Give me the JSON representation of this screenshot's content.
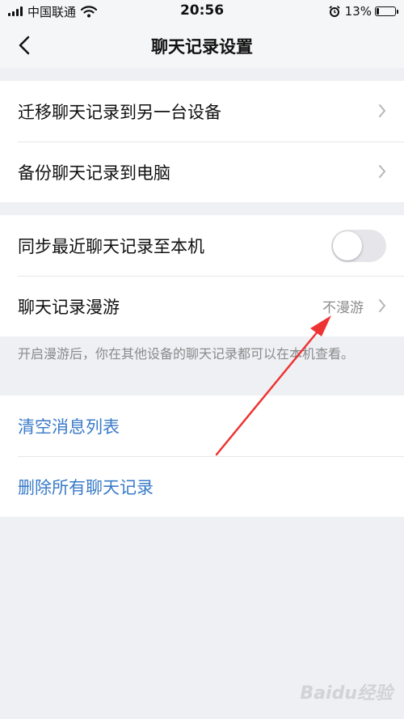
{
  "status_bar": {
    "carrier": "中国联通",
    "time": "20:56",
    "battery_percent": "13%",
    "battery_level": 0.13,
    "icons": [
      "signal-bars-icon",
      "wifi-icon",
      "alarm-icon",
      "battery-icon"
    ]
  },
  "nav": {
    "title": "聊天记录设置",
    "back_icon": "chevron-left-icon"
  },
  "group1": {
    "items": [
      {
        "label": "迁移聊天记录到另一台设备",
        "icon": "chevron-right-icon"
      },
      {
        "label": "备份聊天记录到电脑",
        "icon": "chevron-right-icon"
      }
    ]
  },
  "group2": {
    "sync_label": "同步最近聊天记录至本机",
    "sync_enabled": false,
    "roaming_label": "聊天记录漫游",
    "roaming_value": "不漫游"
  },
  "hint_text": "开启漫游后，你在其他设备的聊天记录都可以在本机查看。",
  "group3": {
    "clear_label": "清空消息列表",
    "delete_label": "删除所有聊天记录"
  },
  "watermark_text": "Baidu经验",
  "colors": {
    "background": "#eff0f4",
    "link_blue": "#3a7bc8",
    "annotation_red": "#ee3333",
    "toggle_off": "#e5e5ea"
  }
}
